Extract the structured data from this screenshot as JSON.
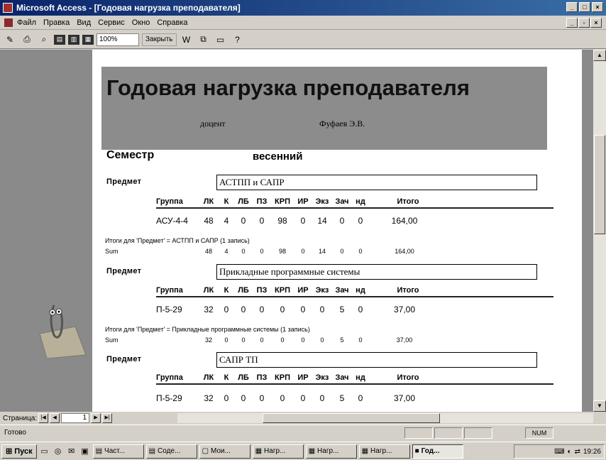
{
  "window": {
    "title": "Microsoft Access - [Годовая нагрузка преподавателя]"
  },
  "menu": [
    "Файл",
    "Правка",
    "Вид",
    "Сервис",
    "Окно",
    "Справка"
  ],
  "toolbar": {
    "zoom": "100%",
    "close_label": "Закрыть"
  },
  "report": {
    "title": "Годовая нагрузка преподавателя",
    "post": "доцент",
    "teacher": "Фуфаев Э.В.",
    "semester_label": "Семестр",
    "semester_value": "весенний",
    "subject_label": "Предмет",
    "columns": [
      "Группа",
      "ЛК",
      "К",
      "ЛБ",
      "ПЗ",
      "КРП",
      "ИР",
      "Экз",
      "Зач",
      "нд",
      "Итого"
    ],
    "sum_label": "Sum",
    "sections": [
      {
        "subject": "АСТПП и САПР",
        "row": [
          "АСУ-4-4",
          "48",
          "4",
          "0",
          "0",
          "98",
          "0",
          "14",
          "0",
          "0",
          "164,00"
        ],
        "totals_text": "Итоги для 'Предмет' =  АСТПП и САПР (1 запись)",
        "sum": [
          "48",
          "4",
          "0",
          "0",
          "98",
          "0",
          "14",
          "0",
          "0",
          "164,00"
        ]
      },
      {
        "subject": "Прикладные программные системы",
        "row": [
          "П-5-29",
          "32",
          "0",
          "0",
          "0",
          "0",
          "0",
          "0",
          "5",
          "0",
          "37,00"
        ],
        "totals_text": "Итоги для 'Предмет' =  Прикладные программные системы (1 запись)",
        "sum": [
          "32",
          "0",
          "0",
          "0",
          "0",
          "0",
          "0",
          "5",
          "0",
          "37,00"
        ]
      },
      {
        "subject": "САПР ТП",
        "row": [
          "П-5-29",
          "32",
          "0",
          "0",
          "0",
          "0",
          "0",
          "0",
          "5",
          "0",
          "37,00"
        ]
      }
    ]
  },
  "nav": {
    "label": "Страница:",
    "page": "1"
  },
  "status": {
    "text": "Готово",
    "num": "NUM"
  },
  "taskbar": {
    "start": "Пуск",
    "buttons": [
      "Част...",
      "Соде...",
      "Мои...",
      "Нагр...",
      "Нагр...",
      "Нагр...",
      "Год..."
    ],
    "clock": "19:26"
  }
}
